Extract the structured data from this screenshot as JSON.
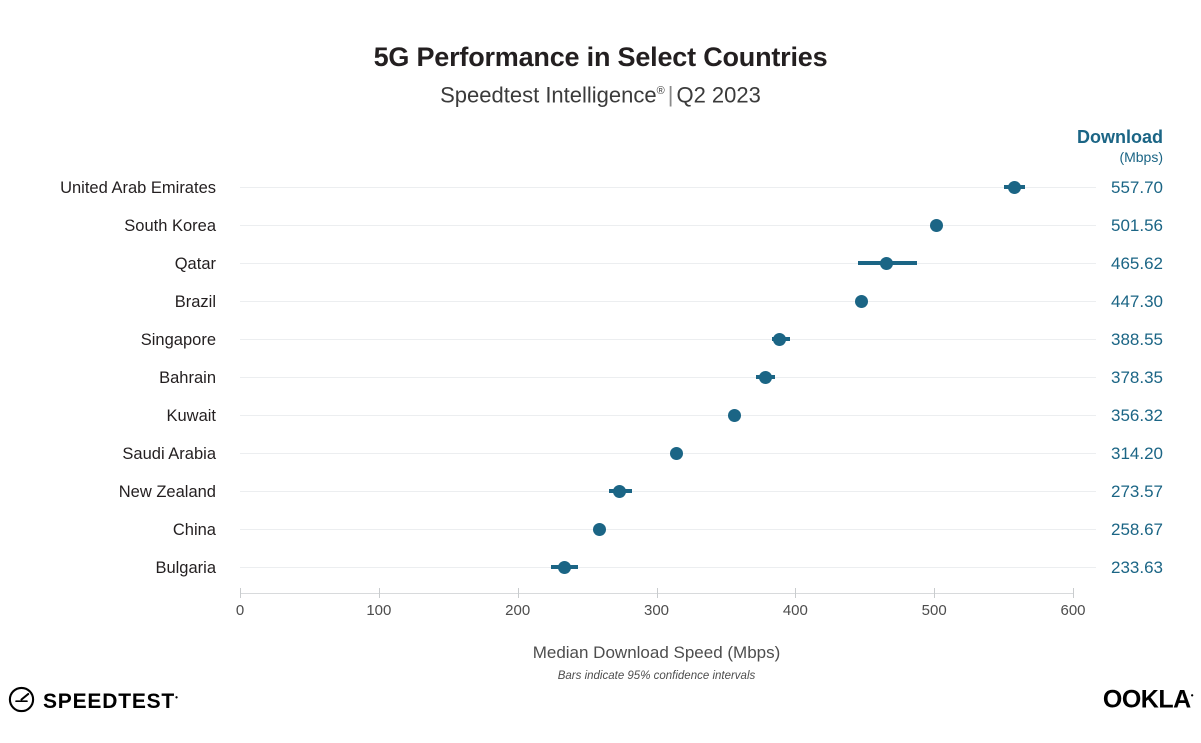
{
  "header": {
    "title": "5G Performance in Select Countries",
    "subtitle_product": "Speedtest Intelligence",
    "subtitle_sup": "®",
    "subtitle_separator": "|",
    "subtitle_period": "Q2 2023"
  },
  "value_column": {
    "header_main": "Download",
    "header_sub": "(Mbps)"
  },
  "footer": {
    "speedtest_wordmark": "SPEEDTEST",
    "speedtest_tm": "•",
    "ookla_wordmark": "OOKLA",
    "ookla_tm": "•"
  },
  "colors": {
    "accent": "#1b6585",
    "text": "#231f20",
    "muted": "#4d4d4d",
    "gridline": "#eceef0"
  },
  "chart_data": {
    "type": "scatter",
    "title": "5G Performance in Select Countries",
    "subtitle": "Speedtest Intelligence® | Q2 2023",
    "xlabel": "Median Download Speed (Mbps)",
    "ylabel": "",
    "annotation": "Bars indicate 95% confidence intervals",
    "xlim": [
      0,
      600
    ],
    "xticks": [
      0,
      100,
      200,
      300,
      400,
      500,
      600
    ],
    "xtick_labels": [
      "0",
      "100",
      "200",
      "300",
      "400",
      "500",
      "600"
    ],
    "grid": "horizontal",
    "legend": "none",
    "value_column_label": "Download (Mbps)",
    "categories": [
      "United Arab Emirates",
      "South Korea",
      "Qatar",
      "Brazil",
      "Singapore",
      "Bahrain",
      "Kuwait",
      "Saudi Arabia",
      "New Zealand",
      "China",
      "Bulgaria"
    ],
    "values": [
      557.7,
      501.56,
      465.62,
      447.3,
      388.55,
      378.35,
      356.32,
      314.2,
      273.57,
      258.67,
      233.63
    ],
    "value_labels": [
      "557.70",
      "501.56",
      "465.62",
      "447.30",
      "388.55",
      "378.35",
      "356.32",
      "314.20",
      "273.57",
      "258.67",
      "233.63"
    ],
    "ci_low": [
      550.5,
      498.0,
      445.0,
      444.5,
      383.0,
      371.5,
      353.0,
      311.5,
      265.5,
      255.0,
      224.0
    ],
    "ci_high": [
      565.5,
      505.5,
      487.5,
      450.0,
      396.0,
      385.5,
      360.0,
      317.0,
      282.0,
      262.5,
      243.5
    ]
  }
}
